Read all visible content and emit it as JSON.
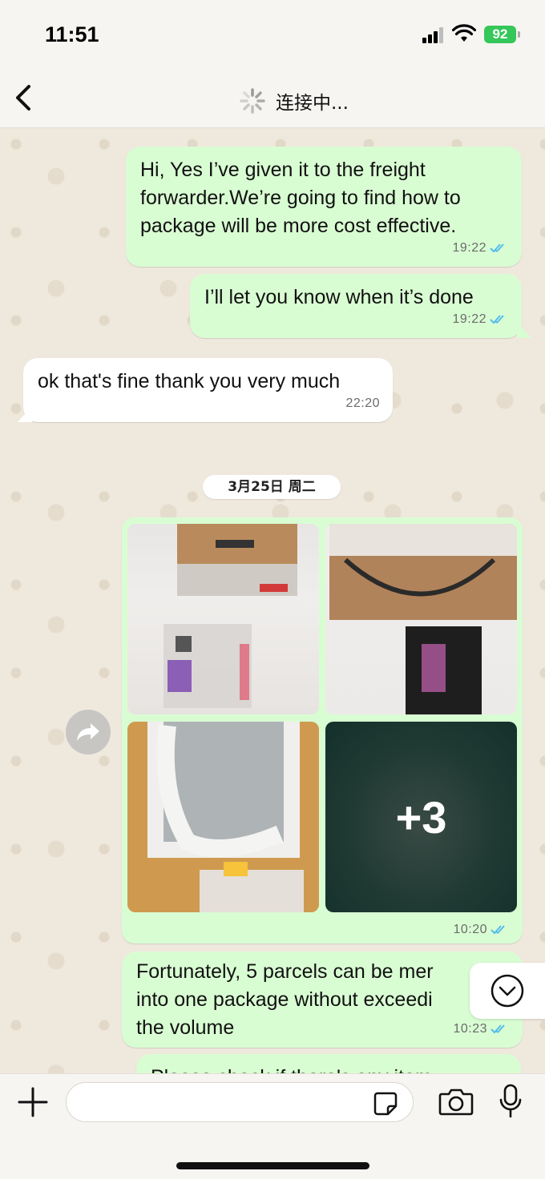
{
  "status_bar": {
    "time": "11:51",
    "battery": "92"
  },
  "header": {
    "title": "连接中..."
  },
  "messages": [
    {
      "direction": "outgoing",
      "text": "Hi, Yes I’ve given it to the freight forwarder.We’re going to find how to package will be more cost effective.",
      "time": "19:22",
      "status": "read"
    },
    {
      "direction": "outgoing",
      "text": "I’ll let you know when it’s done",
      "time": "19:22",
      "status": "read"
    },
    {
      "direction": "incoming",
      "text": "ok that's fine thank you very much",
      "time": "22:20"
    }
  ],
  "date_separator": "3月25日 周二",
  "album": {
    "more_count": "+3",
    "time": "10:20",
    "status": "read"
  },
  "last_message": {
    "line1": "Fortunately, 5 parcels can be mer",
    "line2": "into one package without exceedi",
    "line3": "the volume",
    "time": "10:23",
    "status": "read"
  },
  "partial_message": "Please check if there's any item",
  "composer": {
    "placeholder": ""
  },
  "colors": {
    "outgoing_bubble": "#d9fdd3",
    "incoming_bubble": "#ffffff",
    "read_ticks": "#53bdeb",
    "battery": "#35c759"
  },
  "icons": [
    "back-chevron-icon",
    "spinner-icon",
    "forward-icon",
    "chevron-down-icon",
    "plus-icon",
    "sticker-icon",
    "camera-icon",
    "mic-icon"
  ]
}
